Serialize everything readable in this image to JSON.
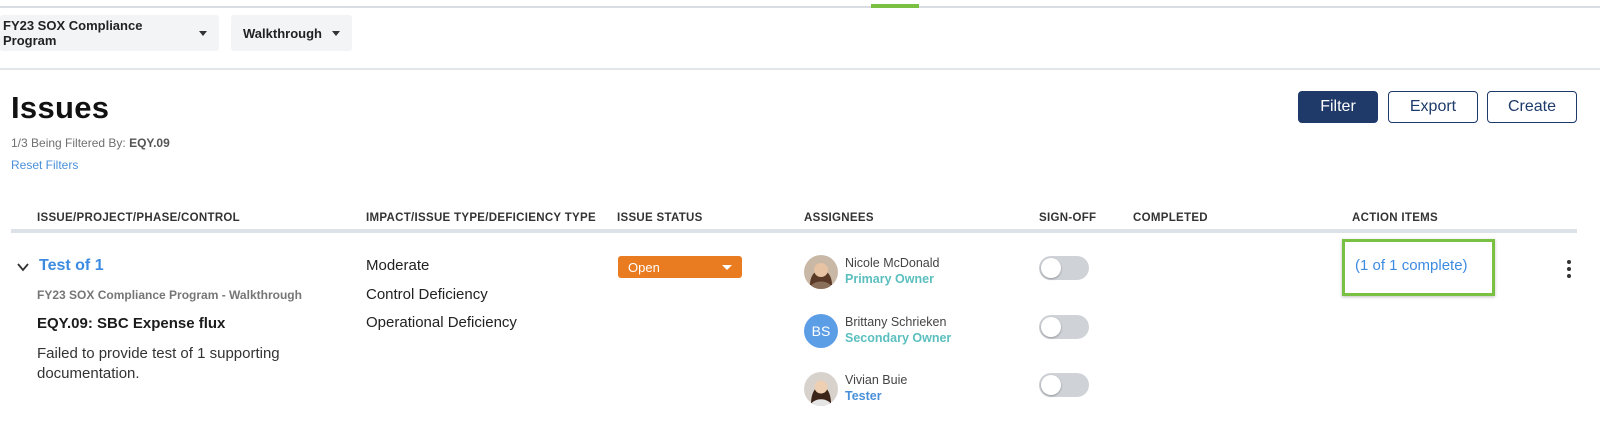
{
  "topbar": {
    "program_label": "FY23 SOX Compliance Program",
    "phase_label": "Walkthrough"
  },
  "page": {
    "title": "Issues",
    "filter_prefix": "1/3 Being Filtered By: ",
    "filter_value": "EQY.09",
    "reset_label": "Reset Filters"
  },
  "toolbar": {
    "filter_label": "Filter",
    "export_label": "Export",
    "create_label": "Create"
  },
  "table": {
    "columns": [
      "ISSUE/PROJECT/PHASE/CONTROL",
      "IMPACT/ISSUE TYPE/DEFICIENCY TYPE",
      "ISSUE STATUS",
      "ASSIGNEES",
      "SIGN-OFF",
      "COMPLETED",
      "ACTION ITEMS"
    ],
    "row": {
      "issue_title": "Test of 1",
      "project_phase": "FY23 SOX Compliance Program - Walkthrough",
      "control": "EQY.09: SBC Expense flux",
      "description": "Failed to provide test of 1 supporting documentation.",
      "impact": "Moderate",
      "issue_type": "Control Deficiency",
      "deficiency_type": "Operational Deficiency",
      "status": "Open",
      "assignees": [
        {
          "name": "Nicole McDonald",
          "role": "Primary Owner",
          "avatar": "photo"
        },
        {
          "name": "Brittany Schrieken",
          "role": "Secondary Owner",
          "avatar": "BS"
        },
        {
          "name": "Vivian Buie",
          "role": "Tester",
          "avatar": "photo"
        }
      ],
      "completed": "",
      "action_items": "(1 of 1 complete)"
    }
  },
  "colors": {
    "accent_green": "#7ac143",
    "primary_navy": "#1f3a68",
    "link_blue": "#3d8be0",
    "status_orange": "#e97b21",
    "role_teal": "#5bbfbf"
  },
  "icons": [
    "chevron-down-icon",
    "caret-down-icon",
    "kebab-menu-icon"
  ]
}
